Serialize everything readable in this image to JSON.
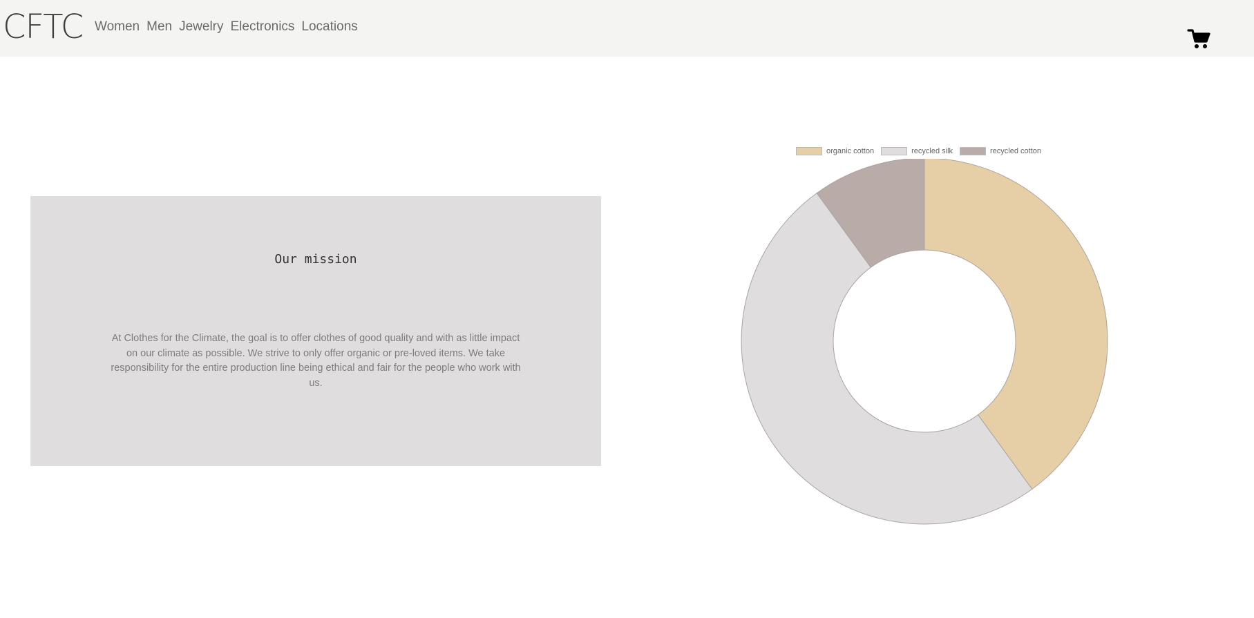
{
  "header": {
    "brand": "CFTC",
    "nav": [
      "Women",
      "Men",
      "Jewelry",
      "Electronics",
      "Locations"
    ],
    "cart_icon": "cart-icon"
  },
  "mission": {
    "title": "Our mission",
    "text": "At Clothes for the Climate, the goal is to offer clothes of good quality and with as little impact on our climate as possible. We strive to only offer organic or pre-loved items. We take responsibility for the entire production line being ethical and fair for the people who work with us."
  },
  "chart_data": {
    "type": "pie",
    "donut": true,
    "legend": "top",
    "categories": [
      "organic cotton",
      "recycled silk",
      "recycled cotton"
    ],
    "values": [
      40,
      50,
      10
    ],
    "colors": [
      "#e6cfa6",
      "#dfdddd",
      "#b9aba7"
    ]
  }
}
